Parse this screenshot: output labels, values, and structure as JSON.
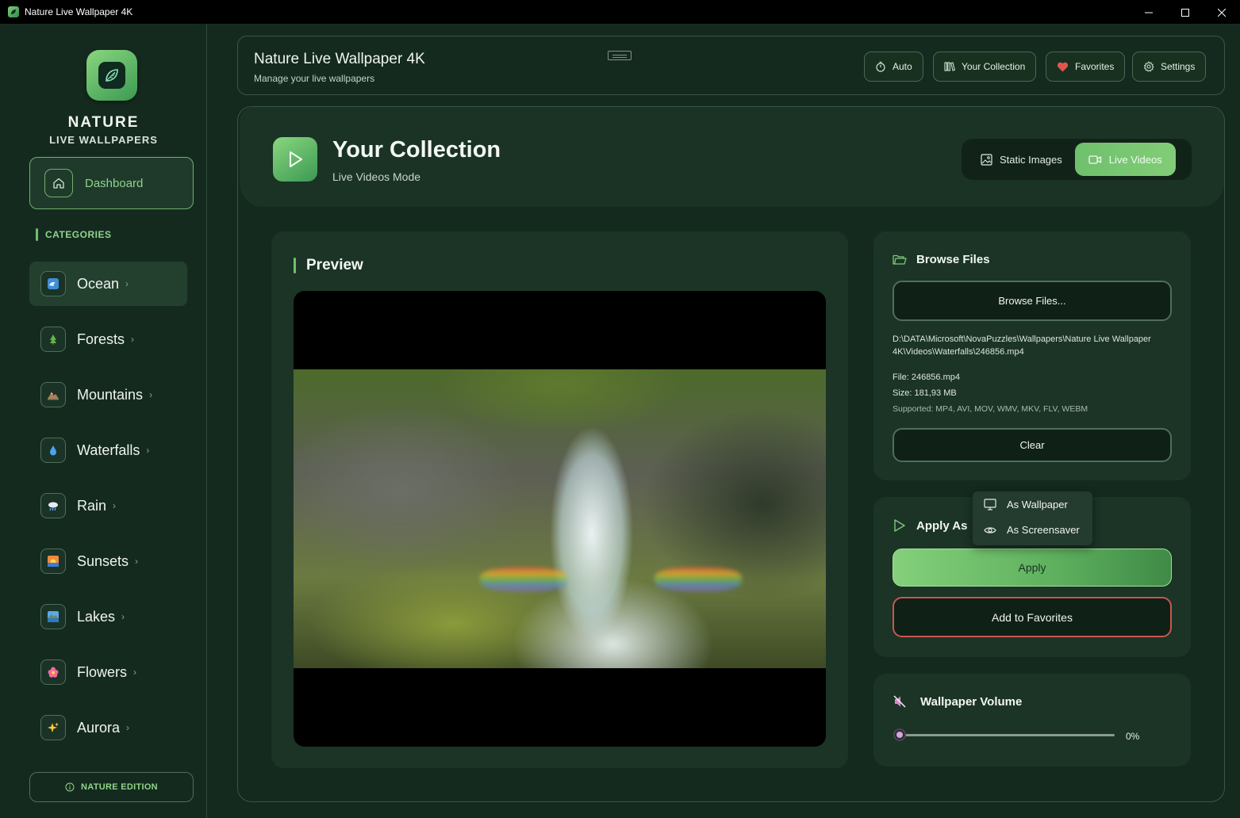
{
  "window": {
    "title": "Nature Live Wallpaper 4K"
  },
  "sidebar": {
    "brand_line1": "NATURE",
    "brand_line2": "LIVE WALLPAPERS",
    "dashboard_label": "Dashboard",
    "categories_title": "CATEGORIES",
    "categories": [
      {
        "label": "Ocean",
        "icon": "wave-icon",
        "active": true
      },
      {
        "label": "Forests",
        "icon": "tree-icon",
        "active": false
      },
      {
        "label": "Mountains",
        "icon": "mountain-icon",
        "active": false
      },
      {
        "label": "Waterfalls",
        "icon": "droplet-icon",
        "active": false
      },
      {
        "label": "Rain",
        "icon": "rain-cloud-icon",
        "active": false
      },
      {
        "label": "Sunsets",
        "icon": "sunset-icon",
        "active": false
      },
      {
        "label": "Lakes",
        "icon": "lake-icon",
        "active": false
      },
      {
        "label": "Flowers",
        "icon": "flower-icon",
        "active": false
      },
      {
        "label": "Aurora",
        "icon": "sparkles-icon",
        "active": false
      }
    ],
    "edition_label": "NATURE EDITION"
  },
  "header": {
    "title": "Nature Live Wallpaper 4K",
    "subtitle": "Manage your live wallpapers",
    "buttons": {
      "auto": "Auto",
      "collection": "Your Collection",
      "favorites": "Favorites",
      "settings": "Settings"
    }
  },
  "collection": {
    "title": "Your Collection",
    "subtitle": "Live Videos Mode",
    "mode_static": "Static Images",
    "mode_live": "Live Videos",
    "active_mode": "Live Videos"
  },
  "preview": {
    "title": "Preview"
  },
  "browse": {
    "title": "Browse Files",
    "button_label": "Browse Files...",
    "path": "D:\\DATA\\Microsoft\\NovaPuzzles\\Wallpapers\\Nature Live Wallpaper 4K\\Videos\\Waterfalls\\246856.mp4",
    "file": "File: 246856.mp4",
    "size": "Size: 181,93 MB",
    "supported": "Supported: MP4, AVI, MOV, WMV, MKV, FLV, WEBM",
    "clear_label": "Clear"
  },
  "apply": {
    "title": "Apply As",
    "menu_items": [
      "As Wallpaper",
      "As Screensaver"
    ],
    "apply_label": "Apply",
    "favorites_label": "Add to Favorites"
  },
  "volume": {
    "title": "Wallpaper Volume",
    "value_text": "0%",
    "value": 0
  },
  "colors": {
    "background": "#152a1f",
    "accent_green": "#6fc06c",
    "favorite_red": "#c9574f"
  }
}
